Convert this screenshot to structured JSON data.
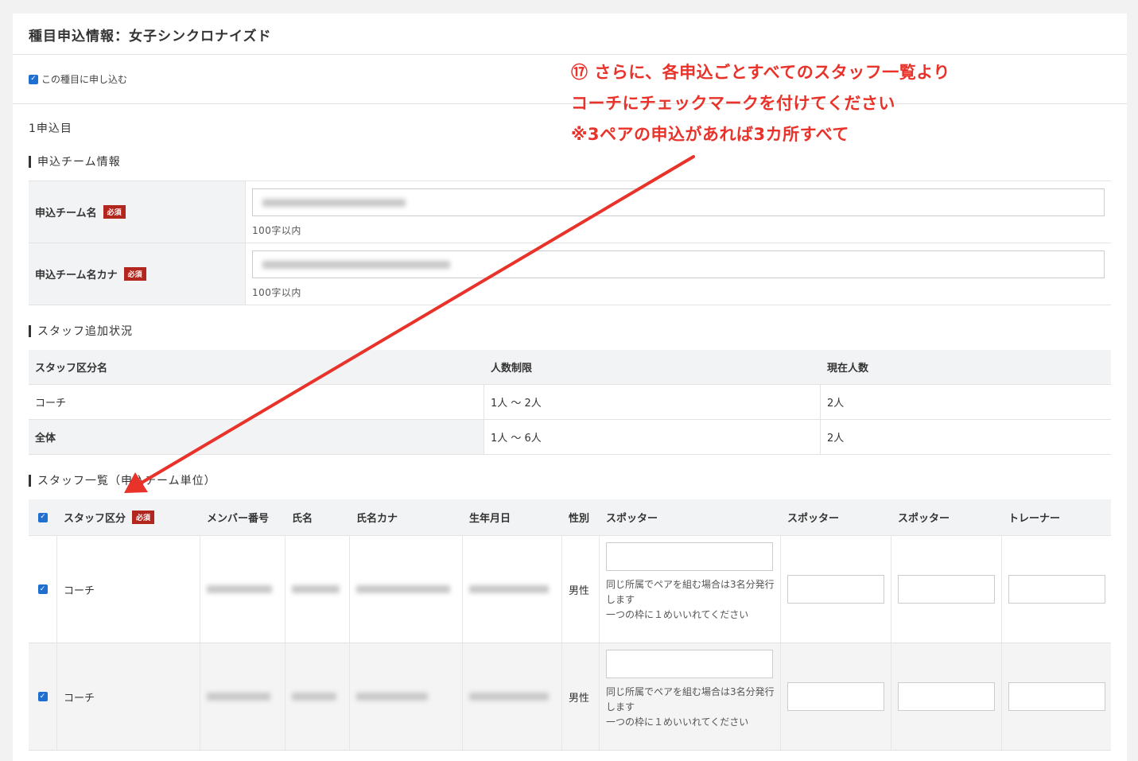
{
  "panel": {
    "title": "種目申込情報：女子シンクロナイズド",
    "apply_label": "この種目に申し込む",
    "entry_no": "1申込目"
  },
  "team_section": {
    "heading": "申込チーム情報",
    "required_label": "必須",
    "fields": [
      {
        "label": "申込チーム名",
        "hint": "100字以内"
      },
      {
        "label": "申込チーム名カナ",
        "hint": "100字以内"
      }
    ]
  },
  "status_section": {
    "heading": "スタッフ追加状況",
    "headers": [
      "スタッフ区分名",
      "人数制限",
      "現在人数"
    ],
    "rows": [
      {
        "name": "コーチ",
        "limit": "1人 〜 2人",
        "current": "2人"
      },
      {
        "name": "全体",
        "limit": "1人 〜 6人",
        "current": "2人"
      }
    ]
  },
  "staff_section": {
    "heading": "スタッフ一覧（申込チーム単位）",
    "headers": [
      "スタッフ区分",
      "メンバー番号",
      "氏名",
      "氏名カナ",
      "生年月日",
      "性別",
      "スポッター",
      "スポッター",
      "スポッター",
      "トレーナー"
    ],
    "rows": [
      {
        "category": "コーチ",
        "gender": "男性",
        "note": "同じ所属でペアを組む場合は3名分発行します\n一つの枠に１めいいれてください"
      },
      {
        "category": "コーチ",
        "gender": "男性",
        "note": "同じ所属でペアを組む場合は3名分発行します\n一つの枠に１めいいれてください"
      }
    ]
  },
  "annotation": {
    "line1": "⑰ さらに、各申込ごとすべてのスタッフ一覧より",
    "line2": "コーチにチェックマークを付けてください",
    "line3": "※3ペアの申込があれば3カ所すべて",
    "color": "#e8322a"
  },
  "colors": {
    "checkbox": "#1f6fd1",
    "required_badge": "#b3261e"
  }
}
